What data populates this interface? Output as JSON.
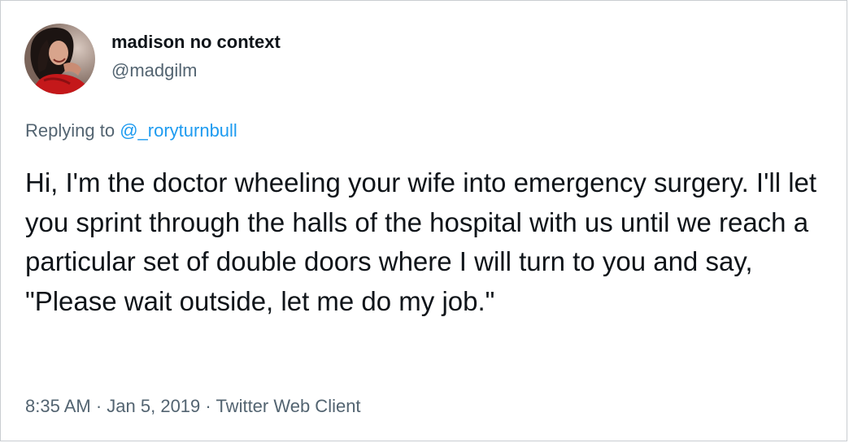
{
  "author": {
    "display_name": "madison no context",
    "handle": "@madgilm"
  },
  "reply": {
    "prefix": "Replying to",
    "mention": "@_roryturnbull"
  },
  "tweet": {
    "text": "Hi, I'm the doctor wheeling your wife into emergency surgery. I'll let you sprint through the halls of the hospital with us until we reach a particular set of double doors where I will turn to you and say, \"Please wait outside, let me do my job.\""
  },
  "meta": {
    "time": "8:35 AM",
    "separator": "·",
    "date": "Jan 5, 2019",
    "client": "Twitter Web Client"
  },
  "colors": {
    "text": "#0f1419",
    "secondary": "#536471",
    "link": "#1d9bf0",
    "border": "#c9cdd1"
  }
}
